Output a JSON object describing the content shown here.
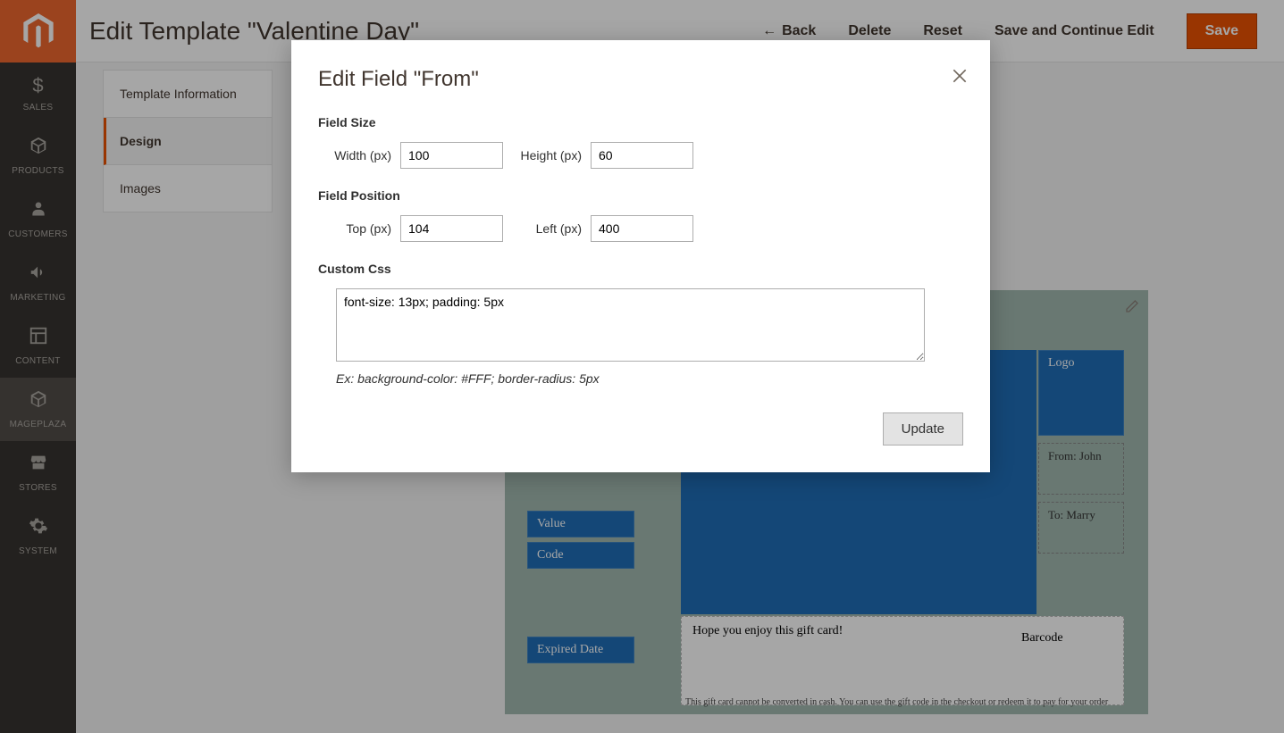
{
  "sidebar": {
    "items": [
      {
        "name": "sales",
        "label": "SALES"
      },
      {
        "name": "products",
        "label": "PRODUCTS"
      },
      {
        "name": "customers",
        "label": "CUSTOMERS"
      },
      {
        "name": "marketing",
        "label": "MARKETING"
      },
      {
        "name": "content",
        "label": "CONTENT"
      },
      {
        "name": "mageplaza",
        "label": "MAGEPLAZA"
      },
      {
        "name": "stores",
        "label": "STORES"
      },
      {
        "name": "system",
        "label": "SYSTEM"
      }
    ]
  },
  "header": {
    "title": "Edit Template \"Valentine Day\"",
    "back": "Back",
    "delete": "Delete",
    "reset": "Reset",
    "save_continue": "Save and Continue Edit",
    "save": "Save"
  },
  "tabs": {
    "items": [
      {
        "label": "Template Information",
        "active": false
      },
      {
        "label": "Design",
        "active": true
      },
      {
        "label": "Images",
        "active": false
      }
    ]
  },
  "canvas": {
    "value": "Value",
    "code": "Code",
    "expired": "Expired Date",
    "logo": "Logo",
    "from": "From: John",
    "to": "To: Marry",
    "message": "Hope you enjoy this gift card!",
    "barcode": "Barcode",
    "note": "This gift card cannot be converted in cash. You can use the gift code in the checkout or redeem it to pay for your order"
  },
  "modal": {
    "title": "Edit Field \"From\"",
    "section_size": "Field Size",
    "width_label": "Width (px)",
    "width_value": "100",
    "height_label": "Height (px)",
    "height_value": "60",
    "section_position": "Field Position",
    "top_label": "Top (px)",
    "top_value": "104",
    "left_label": "Left (px)",
    "left_value": "400",
    "section_css": "Custom Css",
    "css_value": "font-size: 13px; padding: 5px",
    "css_hint": "Ex: background-color: #FFF; border-radius: 5px",
    "update": "Update"
  }
}
